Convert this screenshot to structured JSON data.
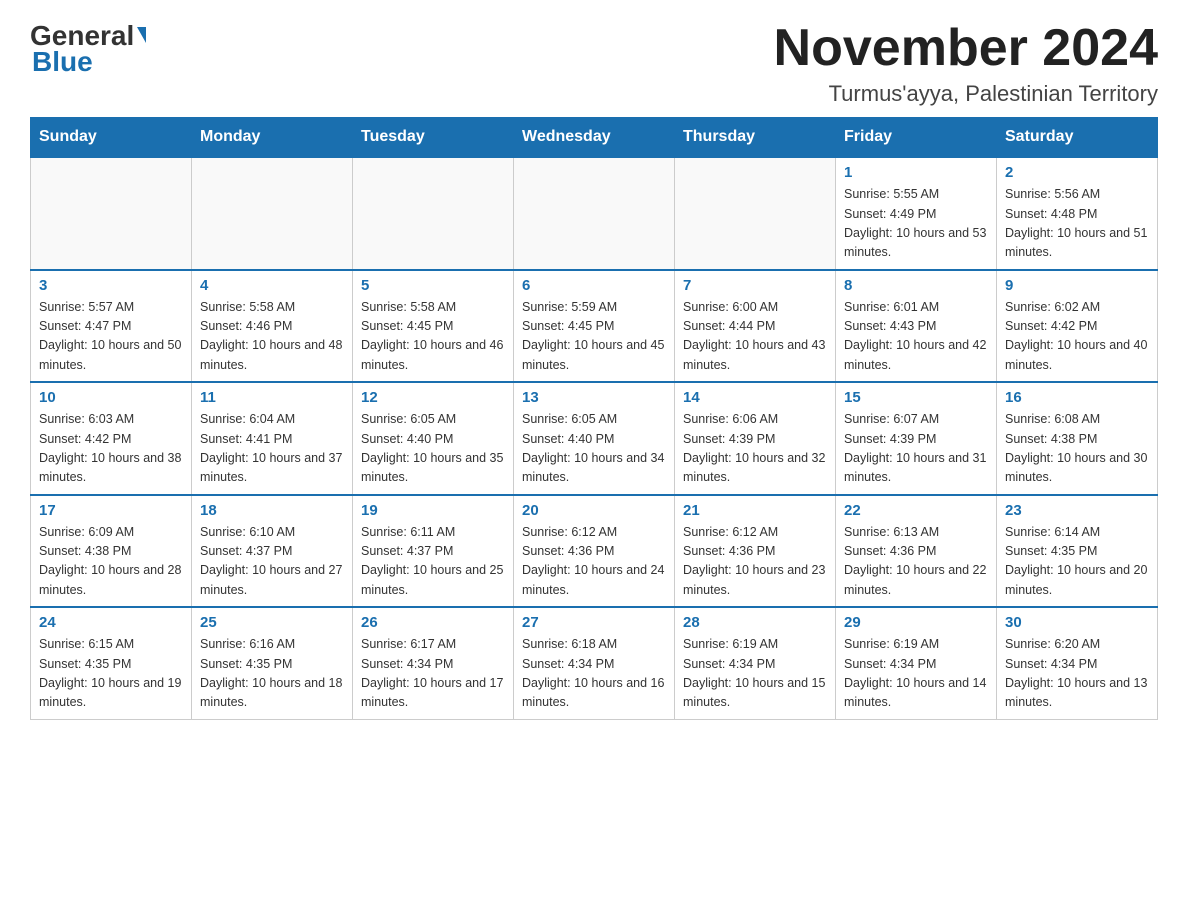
{
  "logo": {
    "general": "General",
    "blue": "Blue"
  },
  "header": {
    "title": "November 2024",
    "subtitle": "Turmus'ayya, Palestinian Territory"
  },
  "weekdays": [
    "Sunday",
    "Monday",
    "Tuesday",
    "Wednesday",
    "Thursday",
    "Friday",
    "Saturday"
  ],
  "weeks": [
    [
      {
        "day": "",
        "info": ""
      },
      {
        "day": "",
        "info": ""
      },
      {
        "day": "",
        "info": ""
      },
      {
        "day": "",
        "info": ""
      },
      {
        "day": "",
        "info": ""
      },
      {
        "day": "1",
        "info": "Sunrise: 5:55 AM\nSunset: 4:49 PM\nDaylight: 10 hours and 53 minutes."
      },
      {
        "day": "2",
        "info": "Sunrise: 5:56 AM\nSunset: 4:48 PM\nDaylight: 10 hours and 51 minutes."
      }
    ],
    [
      {
        "day": "3",
        "info": "Sunrise: 5:57 AM\nSunset: 4:47 PM\nDaylight: 10 hours and 50 minutes."
      },
      {
        "day": "4",
        "info": "Sunrise: 5:58 AM\nSunset: 4:46 PM\nDaylight: 10 hours and 48 minutes."
      },
      {
        "day": "5",
        "info": "Sunrise: 5:58 AM\nSunset: 4:45 PM\nDaylight: 10 hours and 46 minutes."
      },
      {
        "day": "6",
        "info": "Sunrise: 5:59 AM\nSunset: 4:45 PM\nDaylight: 10 hours and 45 minutes."
      },
      {
        "day": "7",
        "info": "Sunrise: 6:00 AM\nSunset: 4:44 PM\nDaylight: 10 hours and 43 minutes."
      },
      {
        "day": "8",
        "info": "Sunrise: 6:01 AM\nSunset: 4:43 PM\nDaylight: 10 hours and 42 minutes."
      },
      {
        "day": "9",
        "info": "Sunrise: 6:02 AM\nSunset: 4:42 PM\nDaylight: 10 hours and 40 minutes."
      }
    ],
    [
      {
        "day": "10",
        "info": "Sunrise: 6:03 AM\nSunset: 4:42 PM\nDaylight: 10 hours and 38 minutes."
      },
      {
        "day": "11",
        "info": "Sunrise: 6:04 AM\nSunset: 4:41 PM\nDaylight: 10 hours and 37 minutes."
      },
      {
        "day": "12",
        "info": "Sunrise: 6:05 AM\nSunset: 4:40 PM\nDaylight: 10 hours and 35 minutes."
      },
      {
        "day": "13",
        "info": "Sunrise: 6:05 AM\nSunset: 4:40 PM\nDaylight: 10 hours and 34 minutes."
      },
      {
        "day": "14",
        "info": "Sunrise: 6:06 AM\nSunset: 4:39 PM\nDaylight: 10 hours and 32 minutes."
      },
      {
        "day": "15",
        "info": "Sunrise: 6:07 AM\nSunset: 4:39 PM\nDaylight: 10 hours and 31 minutes."
      },
      {
        "day": "16",
        "info": "Sunrise: 6:08 AM\nSunset: 4:38 PM\nDaylight: 10 hours and 30 minutes."
      }
    ],
    [
      {
        "day": "17",
        "info": "Sunrise: 6:09 AM\nSunset: 4:38 PM\nDaylight: 10 hours and 28 minutes."
      },
      {
        "day": "18",
        "info": "Sunrise: 6:10 AM\nSunset: 4:37 PM\nDaylight: 10 hours and 27 minutes."
      },
      {
        "day": "19",
        "info": "Sunrise: 6:11 AM\nSunset: 4:37 PM\nDaylight: 10 hours and 25 minutes."
      },
      {
        "day": "20",
        "info": "Sunrise: 6:12 AM\nSunset: 4:36 PM\nDaylight: 10 hours and 24 minutes."
      },
      {
        "day": "21",
        "info": "Sunrise: 6:12 AM\nSunset: 4:36 PM\nDaylight: 10 hours and 23 minutes."
      },
      {
        "day": "22",
        "info": "Sunrise: 6:13 AM\nSunset: 4:36 PM\nDaylight: 10 hours and 22 minutes."
      },
      {
        "day": "23",
        "info": "Sunrise: 6:14 AM\nSunset: 4:35 PM\nDaylight: 10 hours and 20 minutes."
      }
    ],
    [
      {
        "day": "24",
        "info": "Sunrise: 6:15 AM\nSunset: 4:35 PM\nDaylight: 10 hours and 19 minutes."
      },
      {
        "day": "25",
        "info": "Sunrise: 6:16 AM\nSunset: 4:35 PM\nDaylight: 10 hours and 18 minutes."
      },
      {
        "day": "26",
        "info": "Sunrise: 6:17 AM\nSunset: 4:34 PM\nDaylight: 10 hours and 17 minutes."
      },
      {
        "day": "27",
        "info": "Sunrise: 6:18 AM\nSunset: 4:34 PM\nDaylight: 10 hours and 16 minutes."
      },
      {
        "day": "28",
        "info": "Sunrise: 6:19 AM\nSunset: 4:34 PM\nDaylight: 10 hours and 15 minutes."
      },
      {
        "day": "29",
        "info": "Sunrise: 6:19 AM\nSunset: 4:34 PM\nDaylight: 10 hours and 14 minutes."
      },
      {
        "day": "30",
        "info": "Sunrise: 6:20 AM\nSunset: 4:34 PM\nDaylight: 10 hours and 13 minutes."
      }
    ]
  ]
}
